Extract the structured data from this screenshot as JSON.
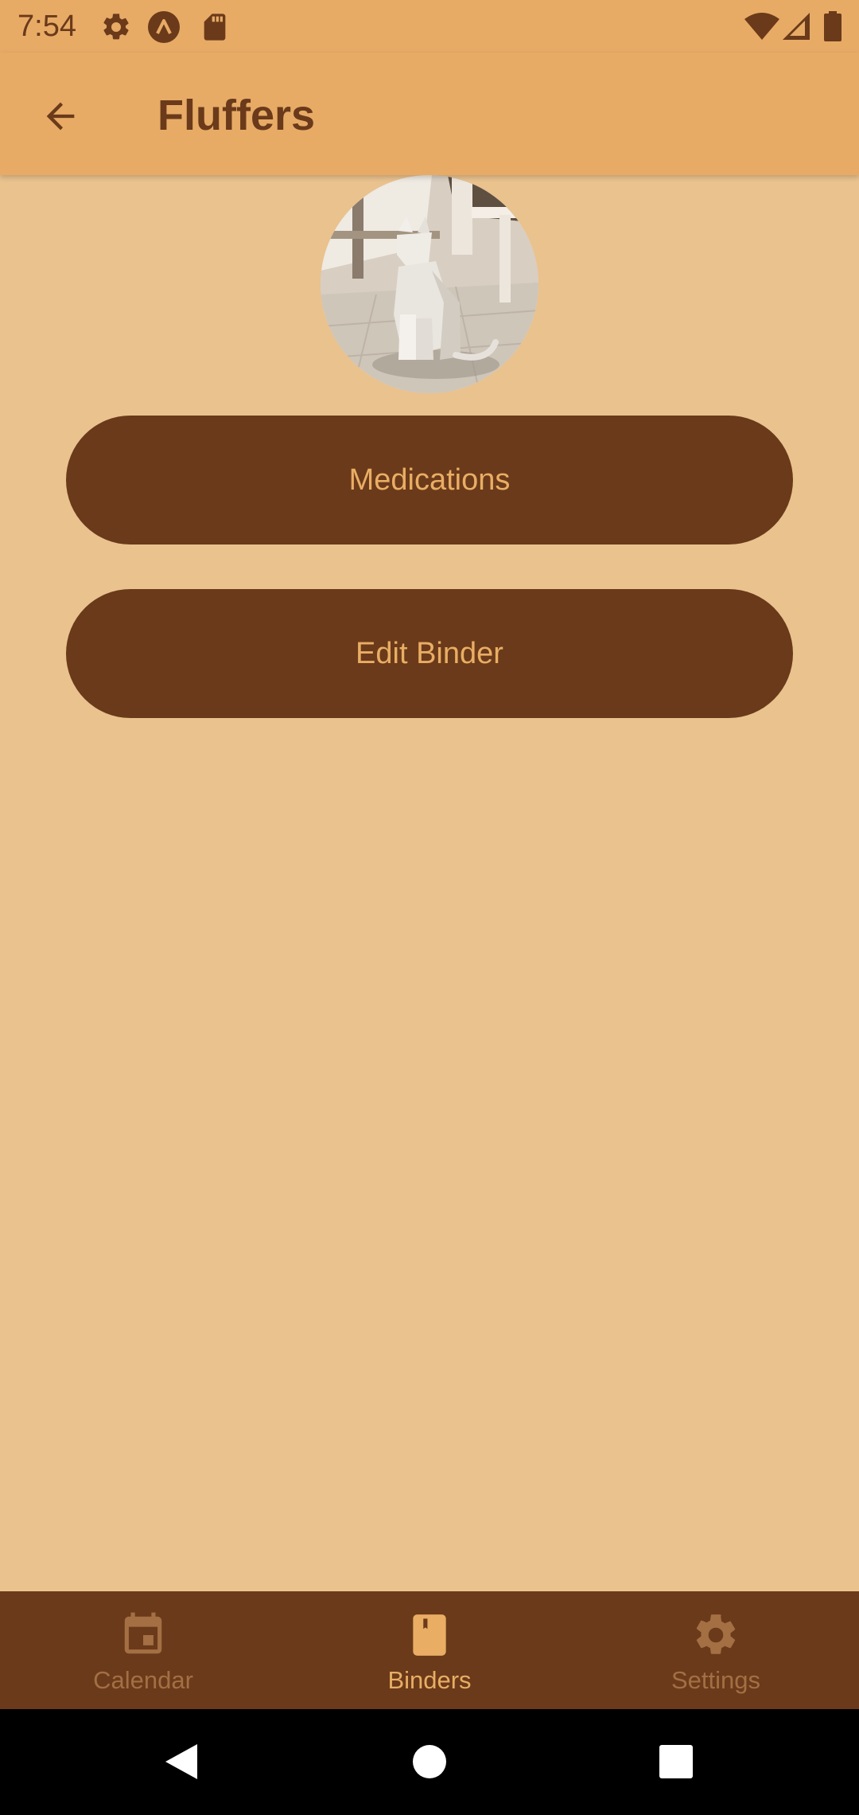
{
  "status_bar": {
    "time": "7:54",
    "left_icons": [
      "gear-icon",
      "app-logo-icon",
      "sd-card-icon"
    ],
    "right_icons": [
      "wifi-icon",
      "cellular-signal-icon",
      "battery-icon"
    ]
  },
  "app_bar": {
    "back_icon": "arrow-left-icon",
    "title": "Fluffers"
  },
  "profile": {
    "avatar": "cat-photo"
  },
  "actions": {
    "medications_label": "Medications",
    "edit_binder_label": "Edit Binder"
  },
  "bottom_nav": {
    "items": [
      {
        "label": "Calendar",
        "icon": "calendar-icon",
        "active": false
      },
      {
        "label": "Binders",
        "icon": "binder-icon",
        "active": true
      },
      {
        "label": "Settings",
        "icon": "gear-icon",
        "active": false
      }
    ]
  },
  "system_nav": {
    "buttons": [
      "back-triangle-icon",
      "home-circle-icon",
      "recents-square-icon"
    ]
  },
  "colors": {
    "background": "#EAC28E",
    "app_bar": "#E7AB66",
    "primary_dark": "#6A3A1A",
    "button_text": "#E9AD64",
    "nav_inactive": "#A36F43"
  }
}
